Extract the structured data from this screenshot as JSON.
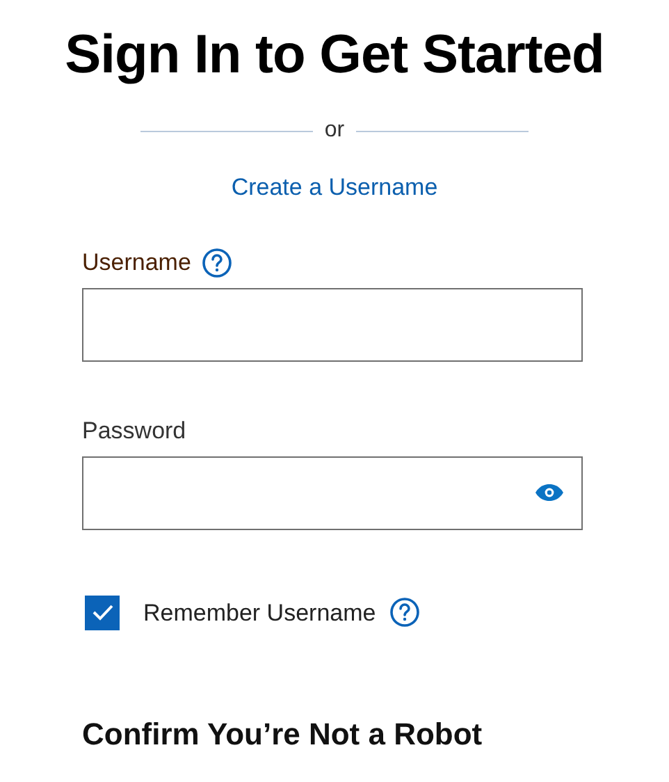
{
  "title": "Sign In to Get Started",
  "divider_text": "or",
  "create_link": "Create a Username",
  "fields": [
    {
      "label": "Username",
      "kind": "help"
    },
    {
      "label": "Password",
      "kind": "password"
    }
  ],
  "remember": {
    "label": "Remember Username",
    "checked": true
  },
  "captcha_heading": "Confirm You’re Not a Robot"
}
